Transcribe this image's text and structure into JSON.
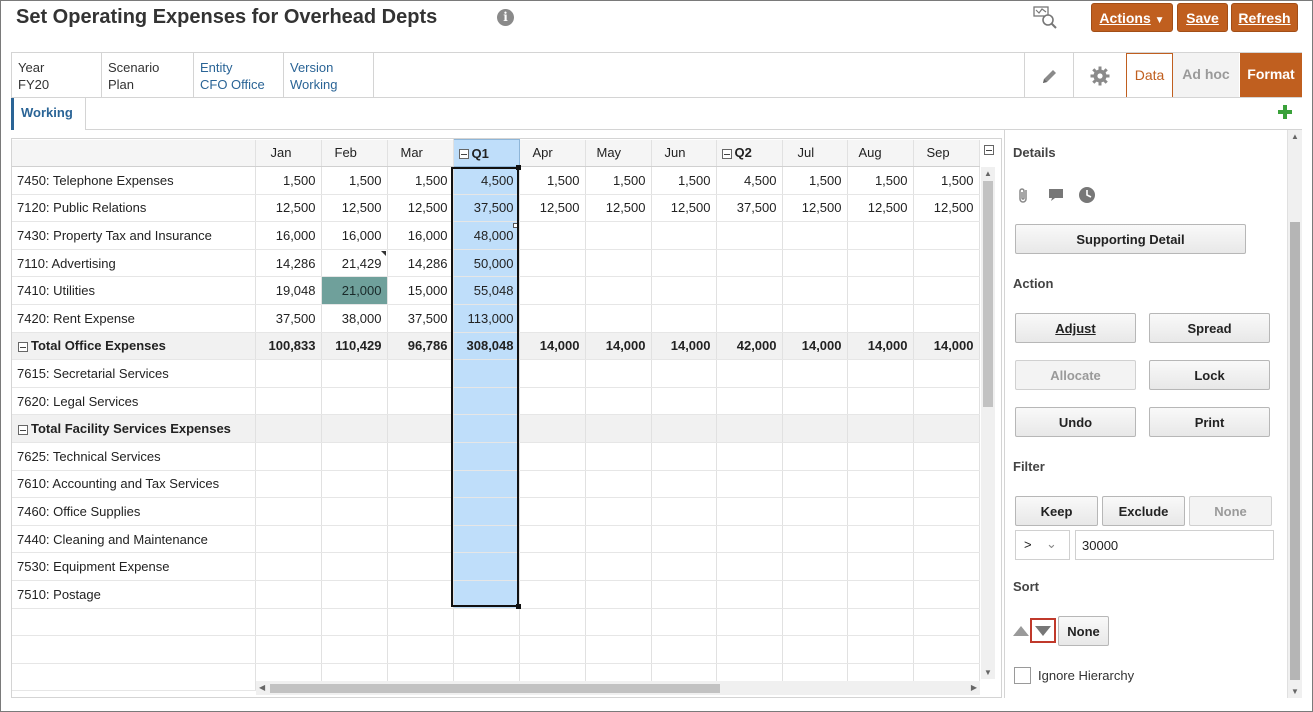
{
  "header": {
    "title": "Set Operating Expenses for Overhead Depts",
    "info_icon": "info-icon",
    "actions_label": "Actions",
    "save_label": "Save",
    "refresh_label": "Refresh",
    "accent_color": "#c05f1f"
  },
  "pov": [
    {
      "label": "Year",
      "value": "FY20",
      "link": false
    },
    {
      "label": "Scenario",
      "value": "Plan",
      "link": false
    },
    {
      "label": "Entity",
      "value": "CFO Office",
      "link": true
    },
    {
      "label": "Version",
      "value": "Working",
      "link": true
    }
  ],
  "view_tabs": {
    "data": "Data",
    "adhoc": "Ad hoc",
    "format": "Format"
  },
  "tab_strip": {
    "working": "Working"
  },
  "grid": {
    "columns": [
      "Jan",
      "Feb",
      "Mar",
      "Q1",
      "Apr",
      "May",
      "Jun",
      "Q2",
      "Jul",
      "Aug",
      "Sep"
    ],
    "rows": [
      {
        "label": "7450: Telephone Expenses",
        "total": false,
        "values": [
          "1,500",
          "1,500",
          "1,500",
          "4,500",
          "1,500",
          "1,500",
          "1,500",
          "4,500",
          "1,500",
          "1,500",
          "1,500"
        ]
      },
      {
        "label": "7120: Public Relations",
        "total": false,
        "values": [
          "12,500",
          "12,500",
          "12,500",
          "37,500",
          "12,500",
          "12,500",
          "12,500",
          "37,500",
          "12,500",
          "12,500",
          "12,500"
        ]
      },
      {
        "label": "7430: Property Tax and Insurance",
        "total": false,
        "values": [
          "16,000",
          "16,000",
          "16,000",
          "48,000",
          "",
          "",
          "",
          "",
          "",
          "",
          ""
        ]
      },
      {
        "label": "7110: Advertising",
        "total": false,
        "values": [
          "14,286",
          "21,429",
          "14,286",
          "50,000",
          "",
          "",
          "",
          "",
          "",
          "",
          ""
        ]
      },
      {
        "label": "7410: Utilities",
        "total": false,
        "values": [
          "19,048",
          "21,000",
          "15,000",
          "55,048",
          "",
          "",
          "",
          "",
          "",
          "",
          ""
        ]
      },
      {
        "label": "7420: Rent Expense",
        "total": false,
        "values": [
          "37,500",
          "38,000",
          "37,500",
          "113,000",
          "",
          "",
          "",
          "",
          "",
          "",
          ""
        ]
      },
      {
        "label": "Total Office Expenses",
        "total": true,
        "values": [
          "100,833",
          "110,429",
          "96,786",
          "308,048",
          "14,000",
          "14,000",
          "14,000",
          "42,000",
          "14,000",
          "14,000",
          "14,000"
        ]
      },
      {
        "label": "7615: Secretarial Services",
        "total": false,
        "values": [
          "",
          "",
          "",
          "",
          "",
          "",
          "",
          "",
          "",
          "",
          ""
        ]
      },
      {
        "label": "7620: Legal Services",
        "total": false,
        "values": [
          "",
          "",
          "",
          "",
          "",
          "",
          "",
          "",
          "",
          "",
          ""
        ]
      },
      {
        "label": "Total Facility Services Expenses",
        "total": true,
        "values": [
          "",
          "",
          "",
          "",
          "",
          "",
          "",
          "",
          "",
          "",
          ""
        ]
      },
      {
        "label": "7625: Technical Services",
        "total": false,
        "values": [
          "",
          "",
          "",
          "",
          "",
          "",
          "",
          "",
          "",
          "",
          ""
        ]
      },
      {
        "label": "7610: Accounting and Tax Services",
        "total": false,
        "values": [
          "",
          "",
          "",
          "",
          "",
          "",
          "",
          "",
          "",
          "",
          ""
        ]
      },
      {
        "label": "7460: Office Supplies",
        "total": false,
        "values": [
          "",
          "",
          "",
          "",
          "",
          "",
          "",
          "",
          "",
          "",
          ""
        ]
      },
      {
        "label": "7440: Cleaning and Maintenance",
        "total": false,
        "values": [
          "",
          "",
          "",
          "",
          "",
          "",
          "",
          "",
          "",
          "",
          ""
        ]
      },
      {
        "label": "7530: Equipment Expense",
        "total": false,
        "values": [
          "",
          "",
          "",
          "",
          "",
          "",
          "",
          "",
          "",
          "",
          ""
        ]
      },
      {
        "label": "7510: Postage",
        "total": false,
        "values": [
          "",
          "",
          "",
          "",
          "",
          "",
          "",
          "",
          "",
          "",
          ""
        ]
      },
      {
        "label": "",
        "total": false,
        "values": [
          "",
          "",
          "",
          "",
          "",
          "",
          "",
          "",
          "",
          "",
          ""
        ]
      },
      {
        "label": "",
        "total": false,
        "values": [
          "",
          "",
          "",
          "",
          "",
          "",
          "",
          "",
          "",
          "",
          ""
        ]
      },
      {
        "label": "",
        "total": false,
        "values": [
          "",
          "",
          "",
          "",
          "",
          "",
          "",
          "",
          "",
          "",
          ""
        ]
      }
    ],
    "highlight_color": "#6fa09b",
    "selection_color": "#bfdefa"
  },
  "panel": {
    "details_label": "Details",
    "supporting_detail_label": "Supporting Detail",
    "action_label": "Action",
    "adjust_label": "Adjust",
    "spread_label": "Spread",
    "allocate_label": "Allocate",
    "lock_label": "Lock",
    "undo_label": "Undo",
    "print_label": "Print",
    "filter_label": "Filter",
    "keep_label": "Keep",
    "exclude_label": "Exclude",
    "filter_none_label": "None",
    "operator_value": ">",
    "filter_value": "30000",
    "sort_label": "Sort",
    "sort_none_label": "None",
    "ignore_hierarchy_label": "Ignore Hierarchy"
  }
}
